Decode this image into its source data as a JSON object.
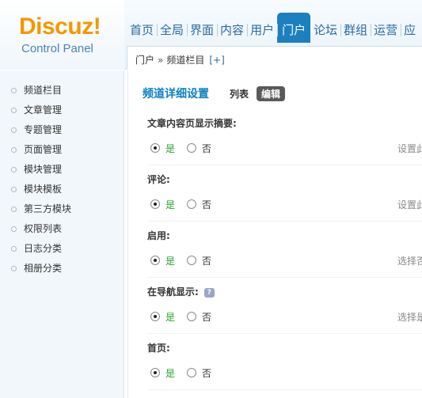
{
  "logo": {
    "title": "Discuz!",
    "subtitle": "Control Panel"
  },
  "nav": {
    "items": [
      {
        "label": "首页",
        "active": false
      },
      {
        "label": "全局",
        "active": false
      },
      {
        "label": "界面",
        "active": false
      },
      {
        "label": "内容",
        "active": false
      },
      {
        "label": "用户",
        "active": false
      },
      {
        "label": "门户",
        "active": true
      },
      {
        "label": "论坛",
        "active": false
      },
      {
        "label": "群组",
        "active": false
      },
      {
        "label": "运营",
        "active": false
      },
      {
        "label": "应",
        "active": false
      }
    ]
  },
  "breadcrumb": {
    "root": "门户",
    "separator": "»",
    "current": "频道栏目",
    "add": "[+]"
  },
  "sidebar": {
    "items": [
      {
        "label": "频道栏目"
      },
      {
        "label": "文章管理"
      },
      {
        "label": "专题管理"
      },
      {
        "label": "页面管理"
      },
      {
        "label": "模块管理"
      },
      {
        "label": "模块模板"
      },
      {
        "label": "第三方模块"
      },
      {
        "label": "权限列表"
      },
      {
        "label": "日志分类"
      },
      {
        "label": "相册分类"
      }
    ]
  },
  "main": {
    "title": "频道详细设置",
    "tab_list": "列表",
    "tab_edit": "编辑",
    "fields": [
      {
        "label": "文章内容页显示摘要:",
        "yes": "是",
        "no": "否",
        "value": "是",
        "hint": "设置此",
        "help": false
      },
      {
        "label": "评论:",
        "yes": "是",
        "no": "否",
        "value": "是",
        "hint": "设置此",
        "help": false
      },
      {
        "label": "启用:",
        "yes": "是",
        "no": "否",
        "value": "是",
        "hint": "选择否",
        "help": false
      },
      {
        "label": "在导航显示:",
        "yes": "是",
        "no": "否",
        "value": "是",
        "hint": "选择是",
        "help": true,
        "help_text": "?"
      },
      {
        "label": "首页:",
        "yes": "是",
        "no": "否",
        "value": "是",
        "hint": "",
        "help": false
      }
    ]
  },
  "colors": {
    "accent": "#1b7fc0",
    "logo": "#f39800",
    "yes_text": "#2aa02a"
  }
}
